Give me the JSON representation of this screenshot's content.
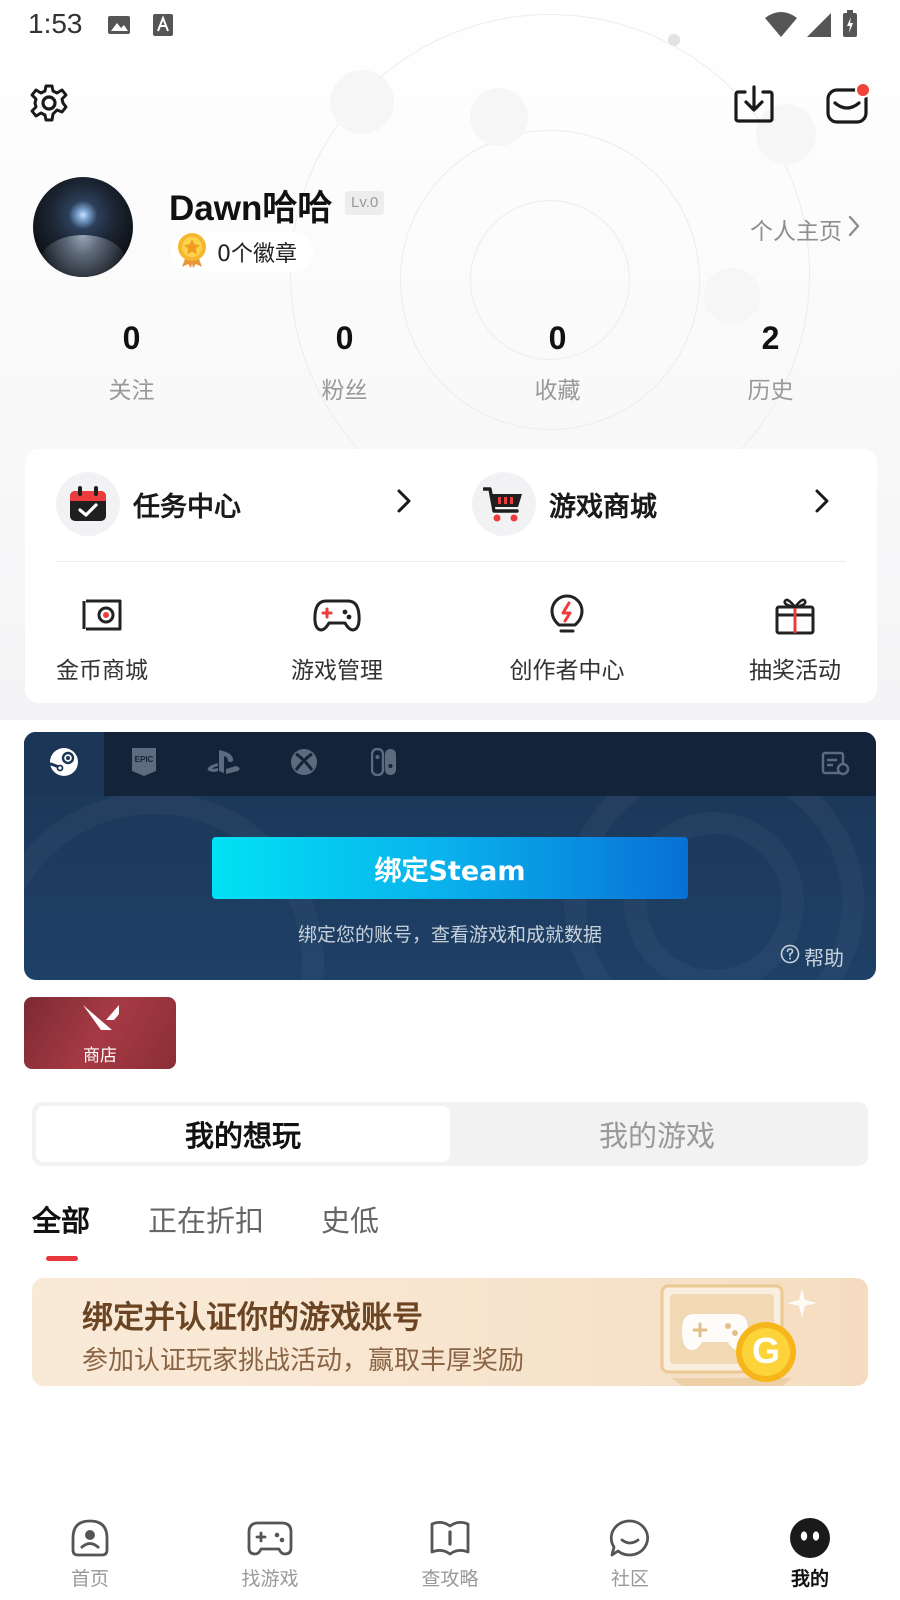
{
  "status_bar": {
    "time": "1:53"
  },
  "profile": {
    "username": "Dawn哈哈",
    "level": "Lv.0",
    "medals": "0个徽章",
    "homepage_link": "个人主页"
  },
  "stats": [
    {
      "value": "0",
      "label": "关注"
    },
    {
      "value": "0",
      "label": "粉丝"
    },
    {
      "value": "0",
      "label": "收藏"
    },
    {
      "value": "2",
      "label": "历史"
    }
  ],
  "services": {
    "primary": [
      {
        "label": "任务中心",
        "icon": "calendar-check-icon"
      },
      {
        "label": "游戏商城",
        "icon": "shopping-cart-icon"
      }
    ],
    "secondary": [
      {
        "label": "金币商城",
        "icon": "coin-store-icon"
      },
      {
        "label": "游戏管理",
        "icon": "gamepad-icon"
      },
      {
        "label": "创作者中心",
        "icon": "bulb-icon"
      },
      {
        "label": "抽奖活动",
        "icon": "gift-icon"
      }
    ]
  },
  "platform_binding": {
    "tabs": [
      "steam-icon",
      "epic-icon",
      "playstation-icon",
      "xbox-icon",
      "switch-icon"
    ],
    "active_tab": "steam-icon",
    "bind_button": "绑定Steam",
    "description": "绑定您的账号，查看游戏和成就数据",
    "help": "帮助"
  },
  "shop_tile": {
    "label": "商店"
  },
  "segment_tabs": {
    "active": "我的想玩",
    "inactive": "我的游戏"
  },
  "filter_tabs": [
    "全部",
    "正在折扣",
    "史低"
  ],
  "promo": {
    "title": "绑定并认证你的游戏账号",
    "subtitle": "参加认证玩家挑战活动，赢取丰厚奖励",
    "coin_letter": "G"
  },
  "bottom_nav": [
    {
      "label": "首页",
      "icon": "home-icon"
    },
    {
      "label": "找游戏",
      "icon": "gamepad-icon"
    },
    {
      "label": "查攻略",
      "icon": "guide-book-icon"
    },
    {
      "label": "社区",
      "icon": "chat-bubble-icon"
    },
    {
      "label": "我的",
      "icon": "profile-face-icon"
    }
  ],
  "colors": {
    "accent_red": "#e8383d",
    "bind_card_bg": "#1b3656",
    "bind_button_start": "#00e2f4",
    "bind_button_end": "#0770d6",
    "promo_bg": "#f9ead8",
    "promo_title": "#6b4423"
  }
}
